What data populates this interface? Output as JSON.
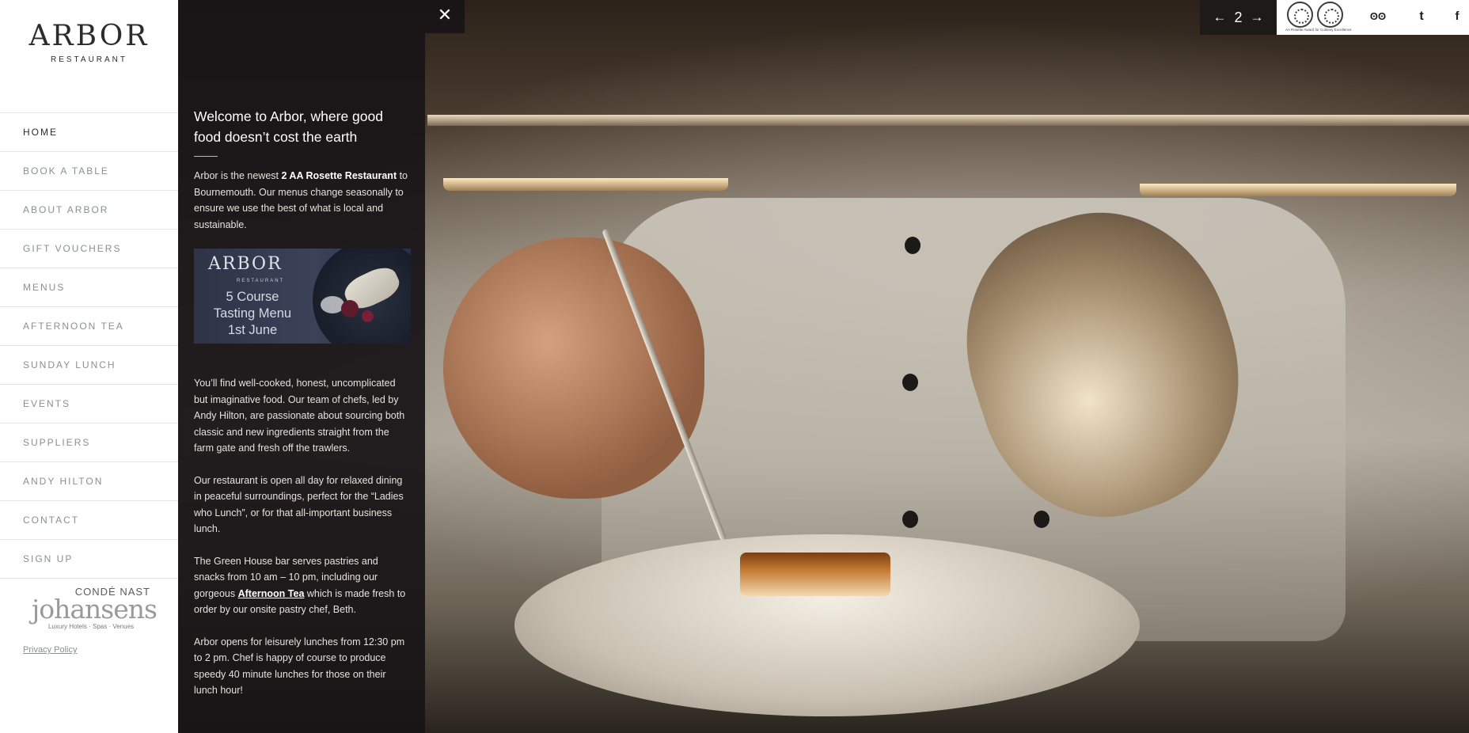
{
  "brand": {
    "name": "ARBOR",
    "subtitle": "RESTAURANT"
  },
  "nav": {
    "items": [
      {
        "label": "HOME",
        "active": true
      },
      {
        "label": "BOOK A TABLE"
      },
      {
        "label": "ABOUT ARBOR"
      },
      {
        "label": "GIFT VOUCHERS"
      },
      {
        "label": "MENUS"
      },
      {
        "label": "AFTERNOON TEA"
      },
      {
        "label": "SUNDAY LUNCH"
      },
      {
        "label": "EVENTS"
      },
      {
        "label": "SUPPLIERS"
      },
      {
        "label": "ANDY HILTON"
      },
      {
        "label": "CONTACT"
      },
      {
        "label": "SIGN UP"
      }
    ]
  },
  "johansens": {
    "top": "CONDÉ NAST",
    "word": "johansens",
    "sub": "Luxury Hotels · Spas · Venues"
  },
  "footer": {
    "privacy": "Privacy Policy"
  },
  "panel": {
    "close_icon": "close-icon",
    "title": "Welcome to Arbor, where good food doesn’t cost the earth",
    "intro_before": "Arbor is the newest ",
    "intro_bold": "2 AA Rosette Restaurant",
    "intro_after": " to Bournemouth. Our menus change seasonally to ensure we use the best of what is local and sustainable.",
    "promo": {
      "brand": "ARBOR",
      "sub": "RESTAURANT",
      "line1": "5 Course",
      "line2": "Tasting Menu",
      "line3": "1st June"
    },
    "para2": "You’ll find well-cooked, honest, uncomplicated but imaginative food. Our team of chefs, led by Andy Hilton, are passionate about sourcing both classic and new ingredients straight from the farm gate and fresh off the trawlers.",
    "para3": "Our restaurant is open all day for relaxed dining in peaceful surroundings, perfect for the “Ladies who Lunch”, or for that all-important business lunch.",
    "para4_before": "The Green House bar serves pastries and snacks from 10 am – 10 pm, including our gorgeous ",
    "para4_link": "Afternoon Tea",
    "para4_after": " which is made fresh to order by our onsite pastry chef, Beth.",
    "para5": "Arbor opens for leisurely lunches from 12:30 pm to 2 pm. Chef is happy of course to produce speedy 40 minute lunches for those on their lunch hour!"
  },
  "pager": {
    "prev_icon": "arrow-left-icon",
    "page": "2",
    "next_icon": "arrow-right-icon"
  },
  "topbar": {
    "rosette_caption": "AA Rosette Award for Culinary Excellence",
    "tripadvisor_glyph": "ʘʘ",
    "twitter_glyph": "t",
    "facebook_glyph": "f"
  },
  "colors": {
    "panel_bg": "#181416",
    "nav_text": "#8a8f93",
    "nav_active": "#2d2d2d"
  }
}
